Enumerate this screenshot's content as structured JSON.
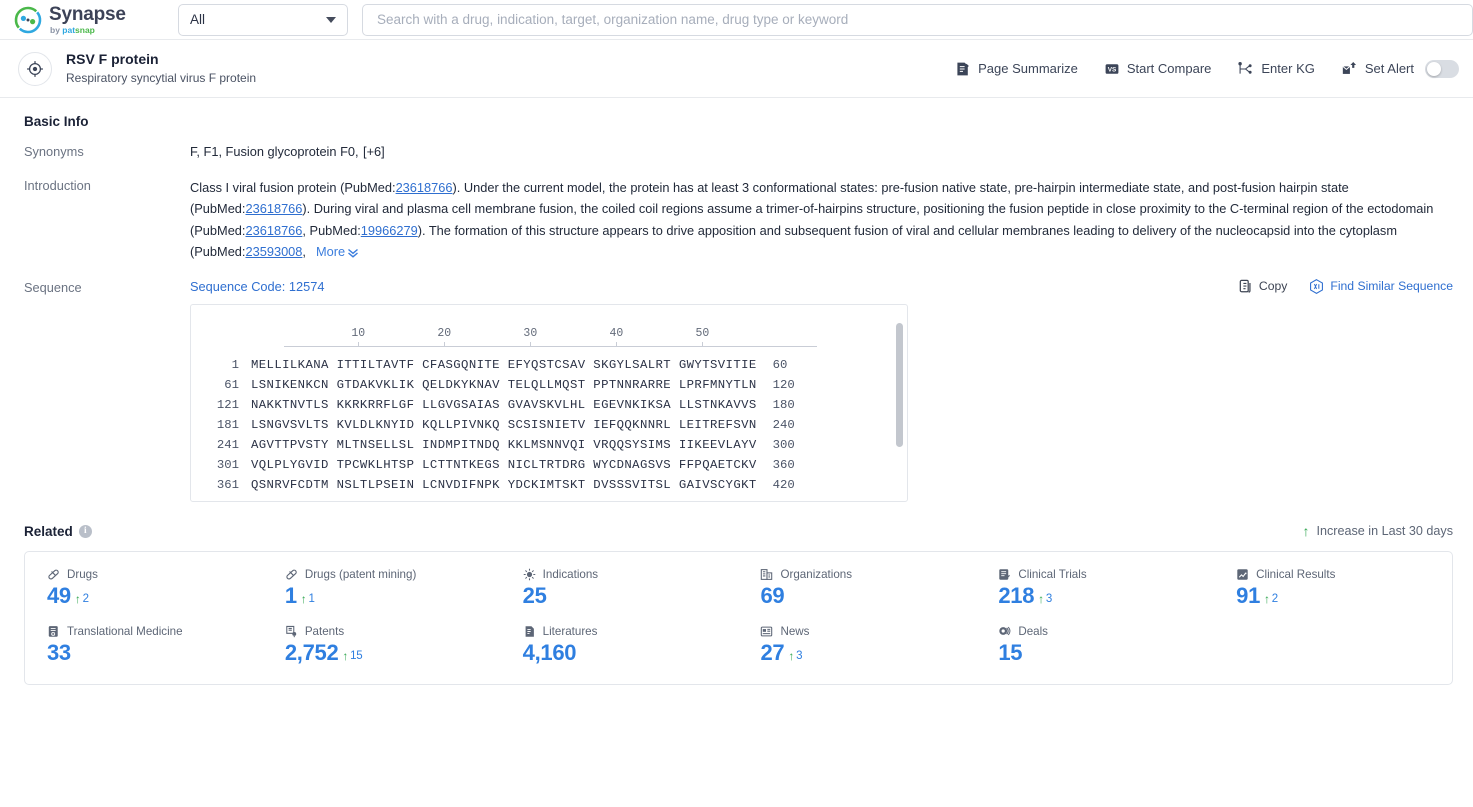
{
  "topbar": {
    "logo_title": "Synapse",
    "logo_sub_prefix": "by ",
    "logo_sub_brand_pat": "pat",
    "logo_sub_brand_snap": "snap",
    "scope_value": "All",
    "search_placeholder": "Search with a drug, indication, target, organization name, drug type or keyword",
    "search_value": ""
  },
  "entity": {
    "name": "RSV F protein",
    "description": "Respiratory syncytial virus F protein",
    "actions": [
      {
        "label": "Page Summarize",
        "icon": "page-summarize-icon"
      },
      {
        "label": "Start Compare",
        "icon": "vs-compare-icon"
      },
      {
        "label": "Enter KG",
        "icon": "knowledge-graph-icon"
      },
      {
        "label": "Set Alert",
        "icon": "alert-bell-icon"
      }
    ],
    "alert_toggle_on": false
  },
  "basic_info": {
    "title": "Basic Info",
    "synonyms_label": "Synonyms",
    "synonyms_value": "F,  F1,  Fusion glycoprotein F0,",
    "synonyms_more": "[+6]",
    "introduction_label": "Introduction",
    "introduction_parts": [
      {
        "t": "Class I viral fusion protein (PubMed:",
        "link": false
      },
      {
        "t": "23618766",
        "link": true
      },
      {
        "t": "). Under the current model, the protein has at least 3 conformational states: pre-fusion native state, pre-hairpin intermediate state, and post-fusion hairpin state (PubMed:",
        "link": false
      },
      {
        "t": "23618766",
        "link": true
      },
      {
        "t": "). During viral and plasma cell membrane fusion, the coiled coil regions assume a trimer-of-hairpins structure, positioning the fusion peptide in close proximity to the C-terminal region of the ectodomain (PubMed:",
        "link": false
      },
      {
        "t": "23618766",
        "link": true
      },
      {
        "t": ", PubMed:",
        "link": false
      },
      {
        "t": "19966279",
        "link": true
      },
      {
        "t": "). The formation of this structure appears to drive apposition and subsequent fusion of viral and cellular membranes leading to delivery of the nucleocapsid into the cytoplasm (PubMed:",
        "link": false
      },
      {
        "t": "23593008",
        "link": true
      },
      {
        "t": ",",
        "link": false
      }
    ],
    "introduction_more": "More"
  },
  "sequence": {
    "label": "Sequence",
    "code_label": "Sequence Code: 12574",
    "copy_label": "Copy",
    "find_similar_label": "Find Similar Sequence",
    "ruler_ticks": [
      10,
      20,
      30,
      40,
      50
    ],
    "rows": [
      {
        "start": "1",
        "blocks": "MELLILKANA ITTILTAVTF CFASGQNITE EFYQSTCSAV SKGYLSALRT GWYTSVITIE",
        "end": "60"
      },
      {
        "start": "61",
        "blocks": "LSNIKENKCN GTDAKVKLIK QELDKYKNAV TELQLLMQST PPTNNRARRE LPRFMNYTLN",
        "end": "120"
      },
      {
        "start": "121",
        "blocks": "NAKKTNVTLS KKRKRRFLGF LLGVGSAIAS GVAVSKVLHL EGEVNKIKSA LLSTNKAVVS",
        "end": "180"
      },
      {
        "start": "181",
        "blocks": "LSNGVSVLTS KVLDLKNYID KQLLPIVNKQ SCSISNIETV IEFQQKNNRL LEITREFSVN",
        "end": "240"
      },
      {
        "start": "241",
        "blocks": "AGVTTPVSTY MLTNSELLSL INDMPITNDQ KKLMSNNVQI VRQQSYSIMS IIKEEVLAYV",
        "end": "300"
      },
      {
        "start": "301",
        "blocks": "VQLPLYGVID TPCWKLHTSP LCTTNTKEGS NICLTRTDRG WYCDNAGSVS FFPQAETCKV",
        "end": "360"
      },
      {
        "start": "361",
        "blocks": "QSNRVFCDTM NSLTLPSEIN LCNVDIFNPK YDCKIMTSKT DVSSSVITSL GAIVSCYGKT",
        "end": "420"
      }
    ]
  },
  "related": {
    "title": "Related",
    "info_char": "i",
    "increase_note": "Increase in Last 30 days",
    "items": [
      {
        "label": "Drugs",
        "icon": "pill-icon",
        "value": "49",
        "delta": "2"
      },
      {
        "label": "Drugs (patent mining)",
        "icon": "pill-icon",
        "value": "1",
        "delta": "1"
      },
      {
        "label": "Indications",
        "icon": "virus-icon",
        "value": "25",
        "delta": ""
      },
      {
        "label": "Organizations",
        "icon": "building-icon",
        "value": "69",
        "delta": ""
      },
      {
        "label": "Clinical Trials",
        "icon": "clinical-trial-icon",
        "value": "218",
        "delta": "3"
      },
      {
        "label": "Clinical Results",
        "icon": "clinical-result-icon",
        "value": "91",
        "delta": "2"
      },
      {
        "label": "Translational Medicine",
        "icon": "translational-icon",
        "value": "33",
        "delta": ""
      },
      {
        "label": "Patents",
        "icon": "patent-icon",
        "value": "2,752",
        "delta": "15"
      },
      {
        "label": "Literatures",
        "icon": "literature-icon",
        "value": "4,160",
        "delta": ""
      },
      {
        "label": "News",
        "icon": "news-icon",
        "value": "27",
        "delta": "3"
      },
      {
        "label": "Deals",
        "icon": "deals-icon",
        "value": "15",
        "delta": ""
      }
    ]
  },
  "colors": {
    "accent_blue": "#2f7fe0",
    "link_blue": "#2f6fd0",
    "increase_green": "#34a853",
    "border": "#e3e6eb"
  }
}
